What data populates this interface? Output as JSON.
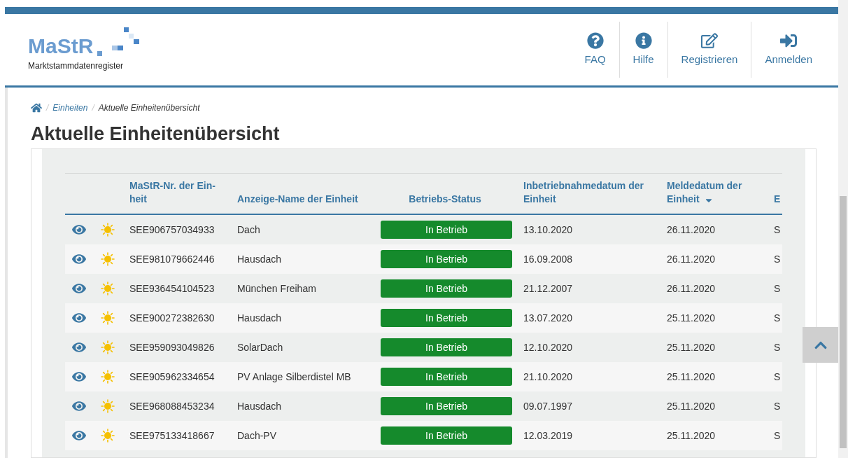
{
  "logo": {
    "wordmark": "MaStR",
    "subtitle": "Marktstammdatenregister"
  },
  "nav": [
    {
      "label": "FAQ"
    },
    {
      "label": "Hilfe"
    },
    {
      "label": "Registrieren"
    },
    {
      "label": "Anmelden"
    }
  ],
  "breadcrumb": [
    {
      "separator": "/",
      "label": "Einheiten",
      "link": true
    },
    {
      "separator": "/",
      "label": "Aktuelle Einheitenübersicht",
      "link": false
    }
  ],
  "title": "Aktuelle Einheitenübersicht",
  "table": {
    "columns": [
      {
        "label": "MaStR-Nr. der Ein-\nheit",
        "sorted": false
      },
      {
        "label": "Anzeige-Name der Einheit",
        "sorted": false
      },
      {
        "label": "Betriebs-Status",
        "sorted": false
      },
      {
        "label": "Inbetriebnahmedatum der Einheit",
        "sorted": false
      },
      {
        "label": "Meldedatum der Einheit",
        "sorted": true
      },
      {
        "label": "E",
        "sorted": false
      }
    ],
    "rows": [
      {
        "number": "SEE906757034933",
        "name": "Dach",
        "status": "In Betrieb",
        "start": "13.10.2020",
        "reported": "26.11.2020",
        "column_8": "S"
      },
      {
        "number": "SEE981079662446",
        "name": "Hausdach",
        "status": "In Betrieb",
        "start": "16.09.2008",
        "reported": "26.11.2020",
        "column_8": "S"
      },
      {
        "number": "SEE936454104523",
        "name": "München Freiham",
        "status": "In Betrieb",
        "start": "21.12.2007",
        "reported": "26.11.2020",
        "column_8": "S"
      },
      {
        "number": "SEE900272382630",
        "name": "Hausdach",
        "status": "In Betrieb",
        "start": "13.07.2020",
        "reported": "25.11.2020",
        "column_8": "S"
      },
      {
        "number": "SEE959093049826",
        "name": "SolarDach",
        "status": "In Betrieb",
        "start": "12.10.2020",
        "reported": "25.11.2020",
        "column_8": "S"
      },
      {
        "number": "SEE905962334654",
        "name": "PV Anlage Silberdistel MB",
        "status": "In Betrieb",
        "start": "21.10.2020",
        "reported": "25.11.2020",
        "column_8": "S"
      },
      {
        "number": "SEE968088453234",
        "name": "Hausdach",
        "status": "In Betrieb",
        "start": "09.07.1997",
        "reported": "25.11.2020",
        "column_8": "S"
      },
      {
        "number": "SEE975133418667",
        "name": "Dach-PV",
        "status": "In Betrieb",
        "start": "12.03.2019",
        "reported": "25.11.2020",
        "column_8": "S"
      }
    ]
  }
}
